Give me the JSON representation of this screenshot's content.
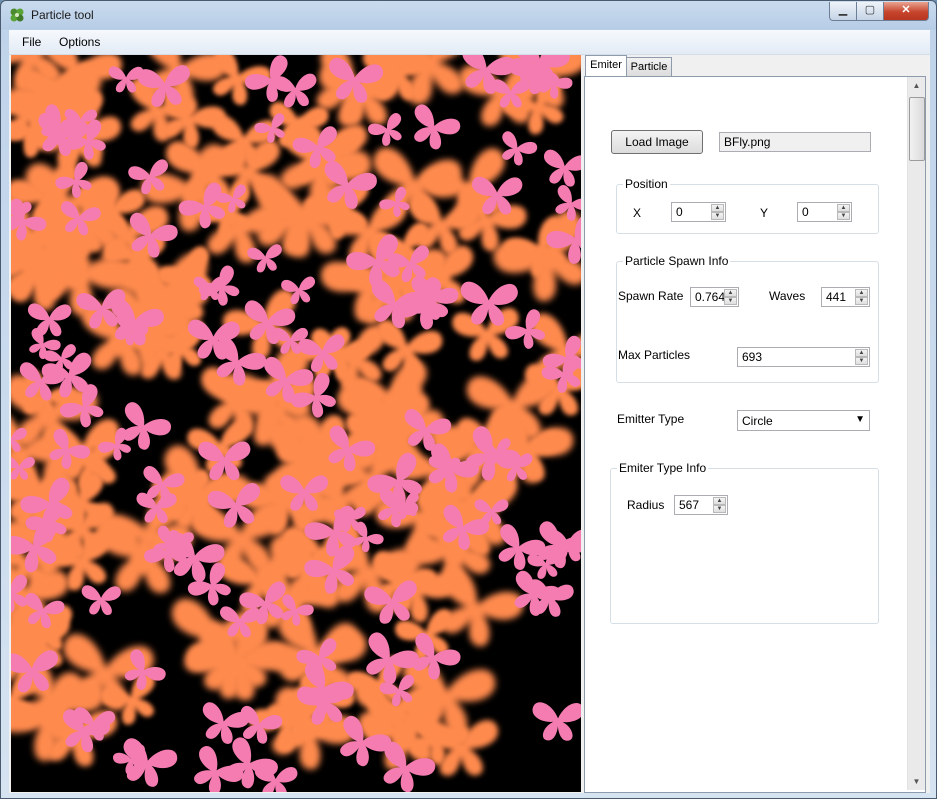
{
  "window": {
    "title": "Particle tool",
    "minimize": "▁",
    "maximize": "▢",
    "close": "✕"
  },
  "menu": {
    "items": [
      "File",
      "Options"
    ]
  },
  "tabs": [
    "Emiter",
    "Particle"
  ],
  "emitter": {
    "load_image_label": "Load Image",
    "image_file": "BFly.png",
    "position": {
      "legend": "Position",
      "x_label": "X",
      "x_value": "0",
      "y_label": "Y",
      "y_value": "0"
    },
    "spawn": {
      "legend": "Particle Spawn Info",
      "spawn_rate_label": "Spawn Rate",
      "spawn_rate_value": "0.764",
      "waves_label": "Waves",
      "waves_value": "441",
      "max_particles_label": "Max Particles",
      "max_particles_value": "693"
    },
    "emitter_type": {
      "label": "Emitter Type",
      "selected": "Circle"
    },
    "type_info": {
      "legend": "Emiter Type Info",
      "radius_label": "Radius",
      "radius_value": "567"
    }
  },
  "colors": {
    "butterfly_orange": "#ff8a4e",
    "butterfly_pink": "#f47cb0",
    "viewport_bg": "#000000"
  }
}
